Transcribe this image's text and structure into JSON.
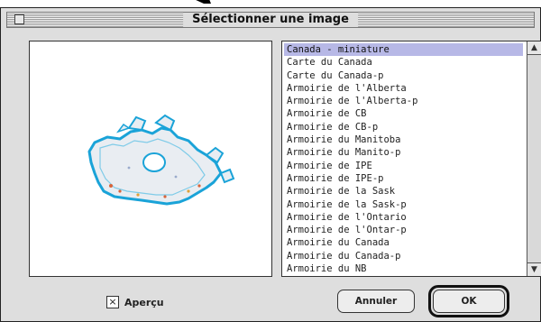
{
  "dialog": {
    "title": "Sélectionner une image"
  },
  "file_list": {
    "items": [
      "Canada - miniature",
      "Carte du Canada",
      "Carte du Canada-p",
      "Armoirie de l'Alberta",
      "Armoirie de l'Alberta-p",
      "Armoirie de CB",
      "Armoirie de CB-p",
      "Armoirie du Manitoba",
      "Armoirie du Manito-p",
      "Armoirie de IPE",
      "Armoirie de IPE-p",
      "Armoirie de la Sask",
      "Armoirie de la Sask-p",
      "Armoirie de l'Ontario",
      "Armoirie de l'Ontar-p",
      "Armoirie du Canada",
      "Armoirie du Canada-p",
      "Armoirie du NB"
    ],
    "selected_index": 0
  },
  "preview_checkbox": {
    "label": "Aperçu",
    "checked": true,
    "mark": "×"
  },
  "buttons": {
    "cancel": "Annuler",
    "ok": "OK"
  },
  "colors": {
    "selection": "#b7b8e6",
    "map_outline": "#1aa3d8"
  },
  "icons": {
    "scroll_up": "scroll-up-arrow-icon",
    "scroll_down": "scroll-down-arrow-icon",
    "close_box": "close-box-icon",
    "pointer": "arrow-pointer-icon"
  }
}
